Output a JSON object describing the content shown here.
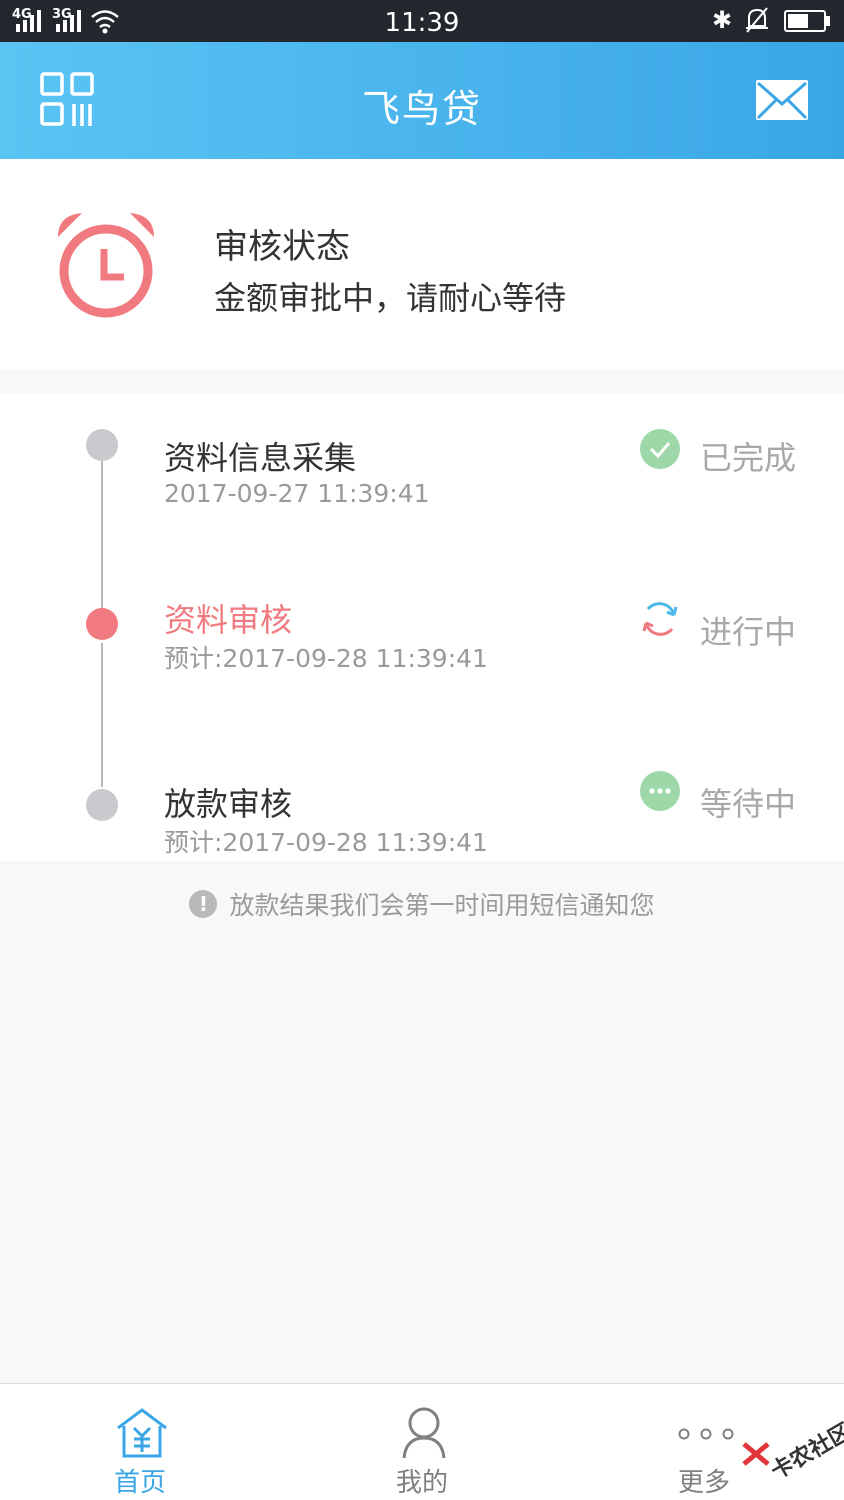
{
  "statusbar": {
    "net1": "4G",
    "net2": "3G",
    "time": "11:39"
  },
  "header": {
    "title": "飞鸟贷",
    "left_icon": "qr-code-icon",
    "right_icon": "mail-icon"
  },
  "review": {
    "title": "审核状态",
    "desc": "金额审批中，请耐心等待",
    "icon": "alarm-clock-icon",
    "accent": "#f07a80"
  },
  "steps": [
    {
      "title": "资料信息采集",
      "time": "2017-09-27 11:39:41",
      "state": "已完成",
      "icon": "check-circle-icon",
      "color": "#9ed8a8"
    },
    {
      "title": "资料审核",
      "time": "预计:2017-09-28 11:39:41",
      "state": "进行中",
      "icon": "refresh-icon",
      "color": "#f07a80"
    },
    {
      "title": "放款审核",
      "time": "预计:2017-09-28 11:39:41",
      "state": "等待中",
      "icon": "more-circle-icon",
      "color": "#9ed8a8"
    }
  ],
  "notice": {
    "text": "放款结果我们会第一时间用短信通知您",
    "icon": "exclamation-circle-icon"
  },
  "nav": [
    {
      "label": "首页",
      "icon": "home-icon",
      "active": true
    },
    {
      "label": "我的",
      "icon": "user-icon",
      "active": false
    },
    {
      "label": "更多",
      "icon": "more-dots-icon",
      "active": false
    }
  ],
  "watermark": "卡农社区",
  "colors": {
    "header_start": "#5ac4f3",
    "header_end": "#3aa6e6",
    "active_nav": "#3aa6e6",
    "accent": "#f07a80"
  }
}
